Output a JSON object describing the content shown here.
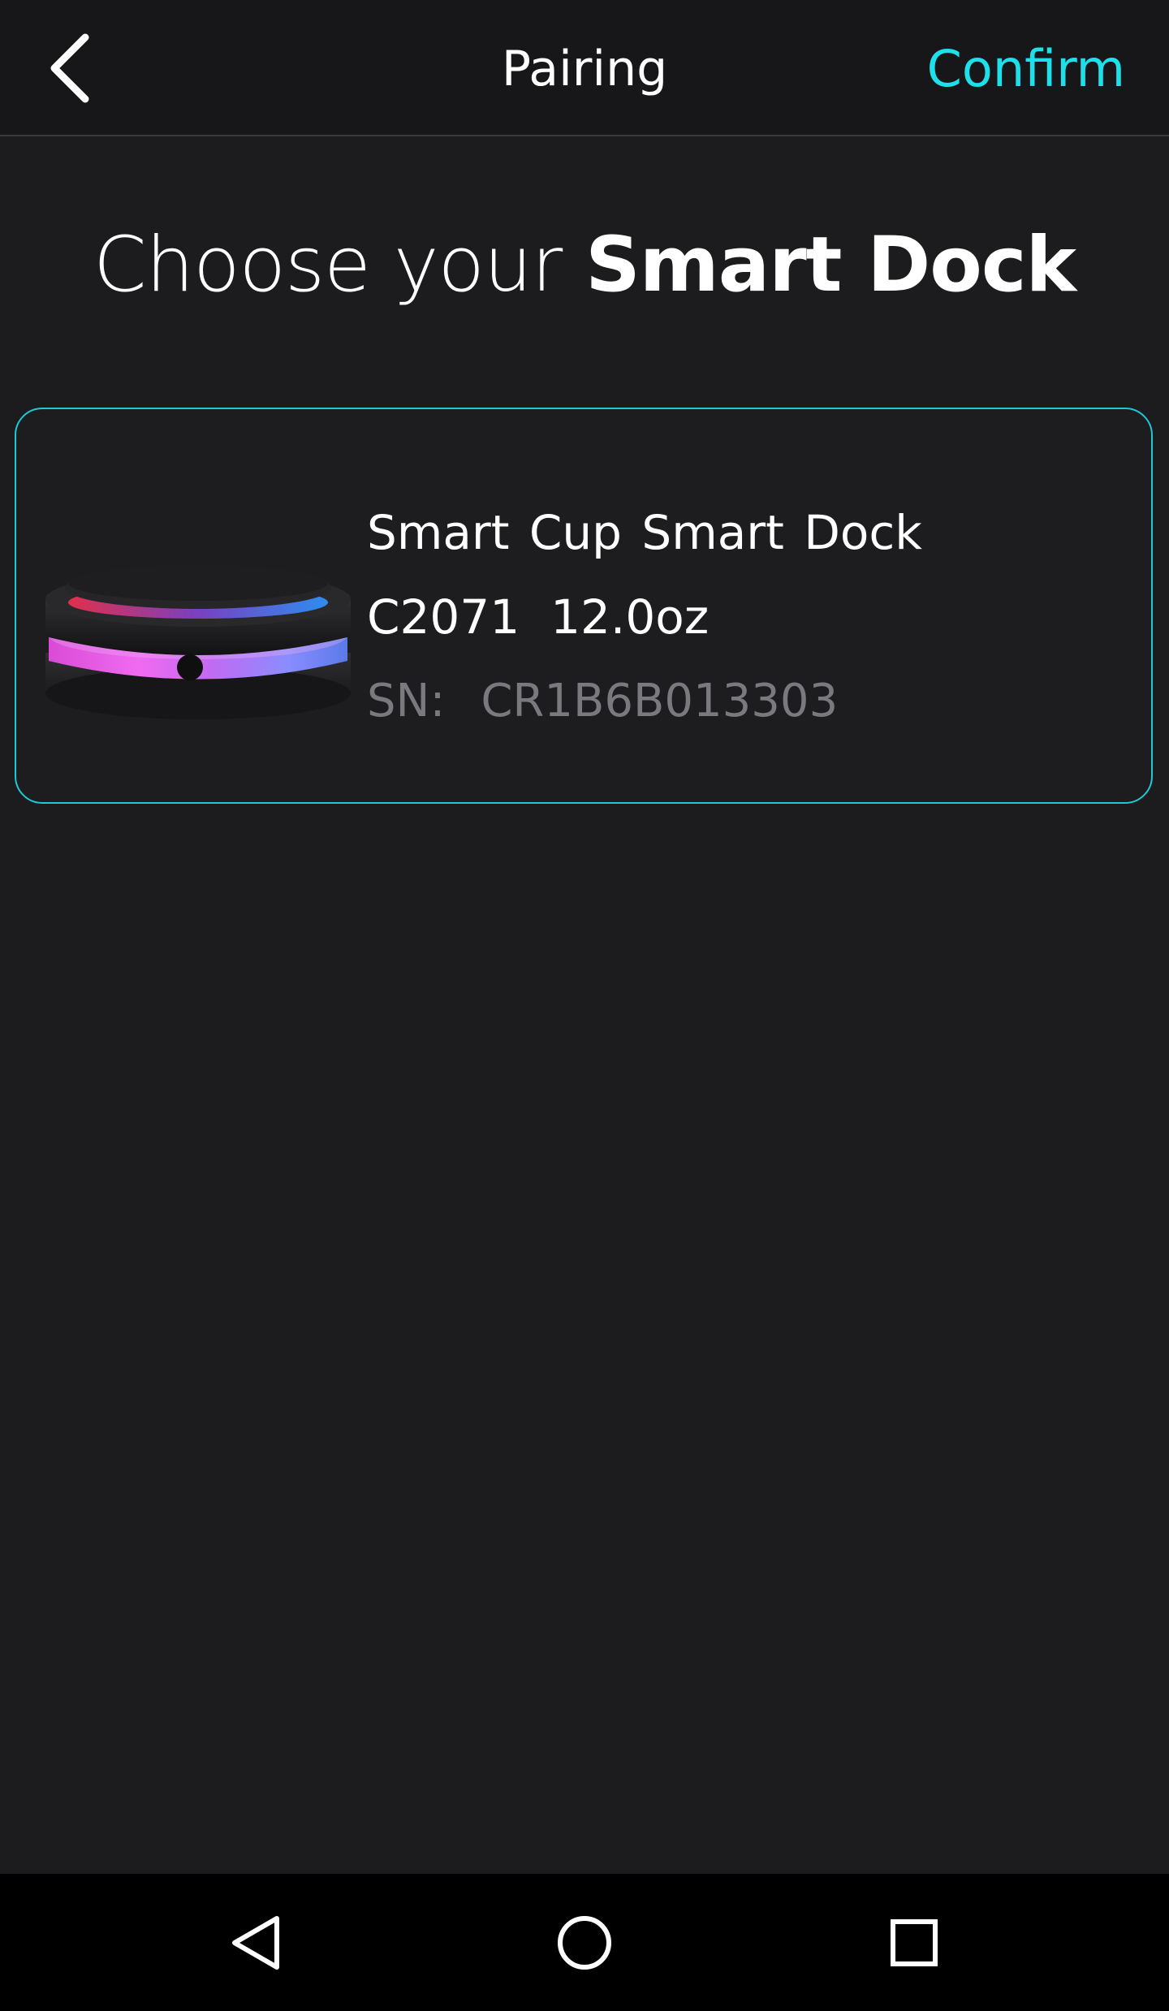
{
  "header": {
    "title": "Pairing",
    "confirm_label": "Confirm",
    "back_icon": "chevron-left-icon"
  },
  "heading": {
    "prefix": "Choose your ",
    "emphasis": "Smart Dock"
  },
  "device": {
    "name": "Smart Cup Smart Dock",
    "model": "C2071",
    "capacity": "12.0oz",
    "sn_label": "SN:",
    "sn_value": "CR1B6B013303",
    "image": "smart-dock-product-photo"
  },
  "navbar": {
    "back_icon": "triangle-back-icon",
    "home_icon": "circle-home-icon",
    "recents_icon": "square-recents-icon"
  },
  "colors": {
    "accent": "#1de0ea",
    "background": "#1c1c1e",
    "card_border": "#1dc9d4",
    "muted_text": "#7a7a7e"
  }
}
